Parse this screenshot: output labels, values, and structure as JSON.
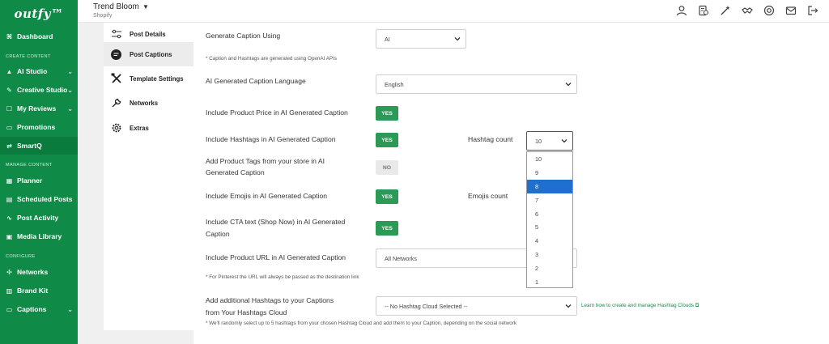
{
  "brand": {
    "logo": "outfy™",
    "accent": "#0f8a47"
  },
  "sidebar": {
    "items": [
      {
        "label": "Dashboard",
        "icon": "dashboard-icon"
      },
      {
        "label": "AI Studio",
        "icon": "ai-icon"
      },
      {
        "label": "Creative Studio",
        "icon": "creative-icon"
      },
      {
        "label": "My Reviews",
        "icon": "reviews-icon"
      },
      {
        "label": "Promotions",
        "icon": "promotions-icon"
      },
      {
        "label": "SmartQ",
        "icon": "smartq-icon"
      },
      {
        "label": "Planner",
        "icon": "planner-icon"
      },
      {
        "label": "Scheduled Posts",
        "icon": "scheduled-icon"
      },
      {
        "label": "Post Activity",
        "icon": "activity-icon"
      },
      {
        "label": "Media Library",
        "icon": "media-icon"
      },
      {
        "label": "Networks",
        "icon": "networks-icon"
      },
      {
        "label": "Brand Kit",
        "icon": "brandkit-icon"
      },
      {
        "label": "Captions",
        "icon": "captions-icon"
      }
    ],
    "sections": {
      "create": "CREATE CONTENT",
      "manage": "MANAGE CONTENT",
      "configure": "CONFIGURE"
    }
  },
  "topbar": {
    "store_name": "Trend Bloom",
    "platform": "Shopify"
  },
  "subnav": {
    "items": [
      {
        "label": "Post Details"
      },
      {
        "label": "Post Captions"
      },
      {
        "label": "Template Settings"
      },
      {
        "label": "Networks"
      },
      {
        "label": "Extras"
      }
    ]
  },
  "form": {
    "generate_label": "Generate Caption Using",
    "generate_value": "AI",
    "generate_note": "* Caption and Hashtags are generated using OpenAI APIs",
    "language_label": "AI Generated Caption Language",
    "language_value": "English",
    "price_label": "Include Product Price in AI Generated Caption",
    "price_value": "YES",
    "hashtags_label": "Include Hashtags in AI Generated Caption",
    "hashtags_value": "YES",
    "hashtag_count_label": "Hashtag count",
    "hashtag_count_value": "10",
    "tags_label_1": "Add Product Tags from your store in AI",
    "tags_label_2": "Generated Caption",
    "tags_value": "NO",
    "emojis_label": "Include Emojis in AI Generated Caption",
    "emojis_value": "YES",
    "emojis_count_label": "Emojis count",
    "cta_label_1": "Include CTA text (Shop Now) in AI Generated",
    "cta_label_2": "Caption",
    "cta_value": "YES",
    "url_label": "Include Product URL in AI Generated Caption",
    "url_value": "All Networks",
    "url_note": "* For Pinterest the URL will always be passed as the destination link",
    "cloud_label_1": "Add additional Hashtags to your Captions",
    "cloud_label_2": "from Your Hashtags Cloud",
    "cloud_value": "-- No Hashtag Cloud Selected --",
    "cloud_link": "Learn how to create and manage Hashtag Clouds",
    "cloud_note": "* We'll randomly select up to 5 hashtags from your chosen Hashtag Cloud and add them to your Caption, depending on the social network"
  },
  "dropdown": {
    "options": [
      "10",
      "9",
      "8",
      "7",
      "6",
      "5",
      "4",
      "3",
      "2",
      "1"
    ],
    "highlighted": "8"
  }
}
